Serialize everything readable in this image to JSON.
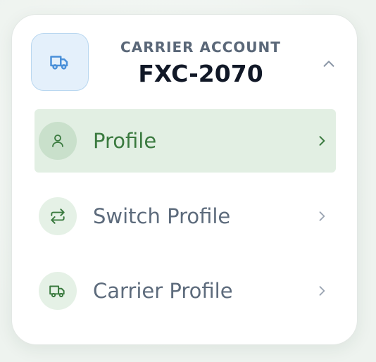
{
  "account": {
    "label": "CARRIER ACCOUNT",
    "id": "FXC-2070",
    "icon": "truck-icon",
    "expanded": true
  },
  "menu": {
    "items": [
      {
        "label": "Profile",
        "icon": "user-icon",
        "active": true
      },
      {
        "label": "Switch Profile",
        "icon": "switch-arrows-icon",
        "active": false
      },
      {
        "label": "Carrier Profile",
        "icon": "truck-icon",
        "active": false
      }
    ]
  },
  "colors": {
    "accent_green": "#3a7a3f",
    "active_bg": "#e2efe3",
    "account_icon_blue": "#4a90d9",
    "muted_text": "#5d6b7c",
    "title_text": "#111827"
  }
}
